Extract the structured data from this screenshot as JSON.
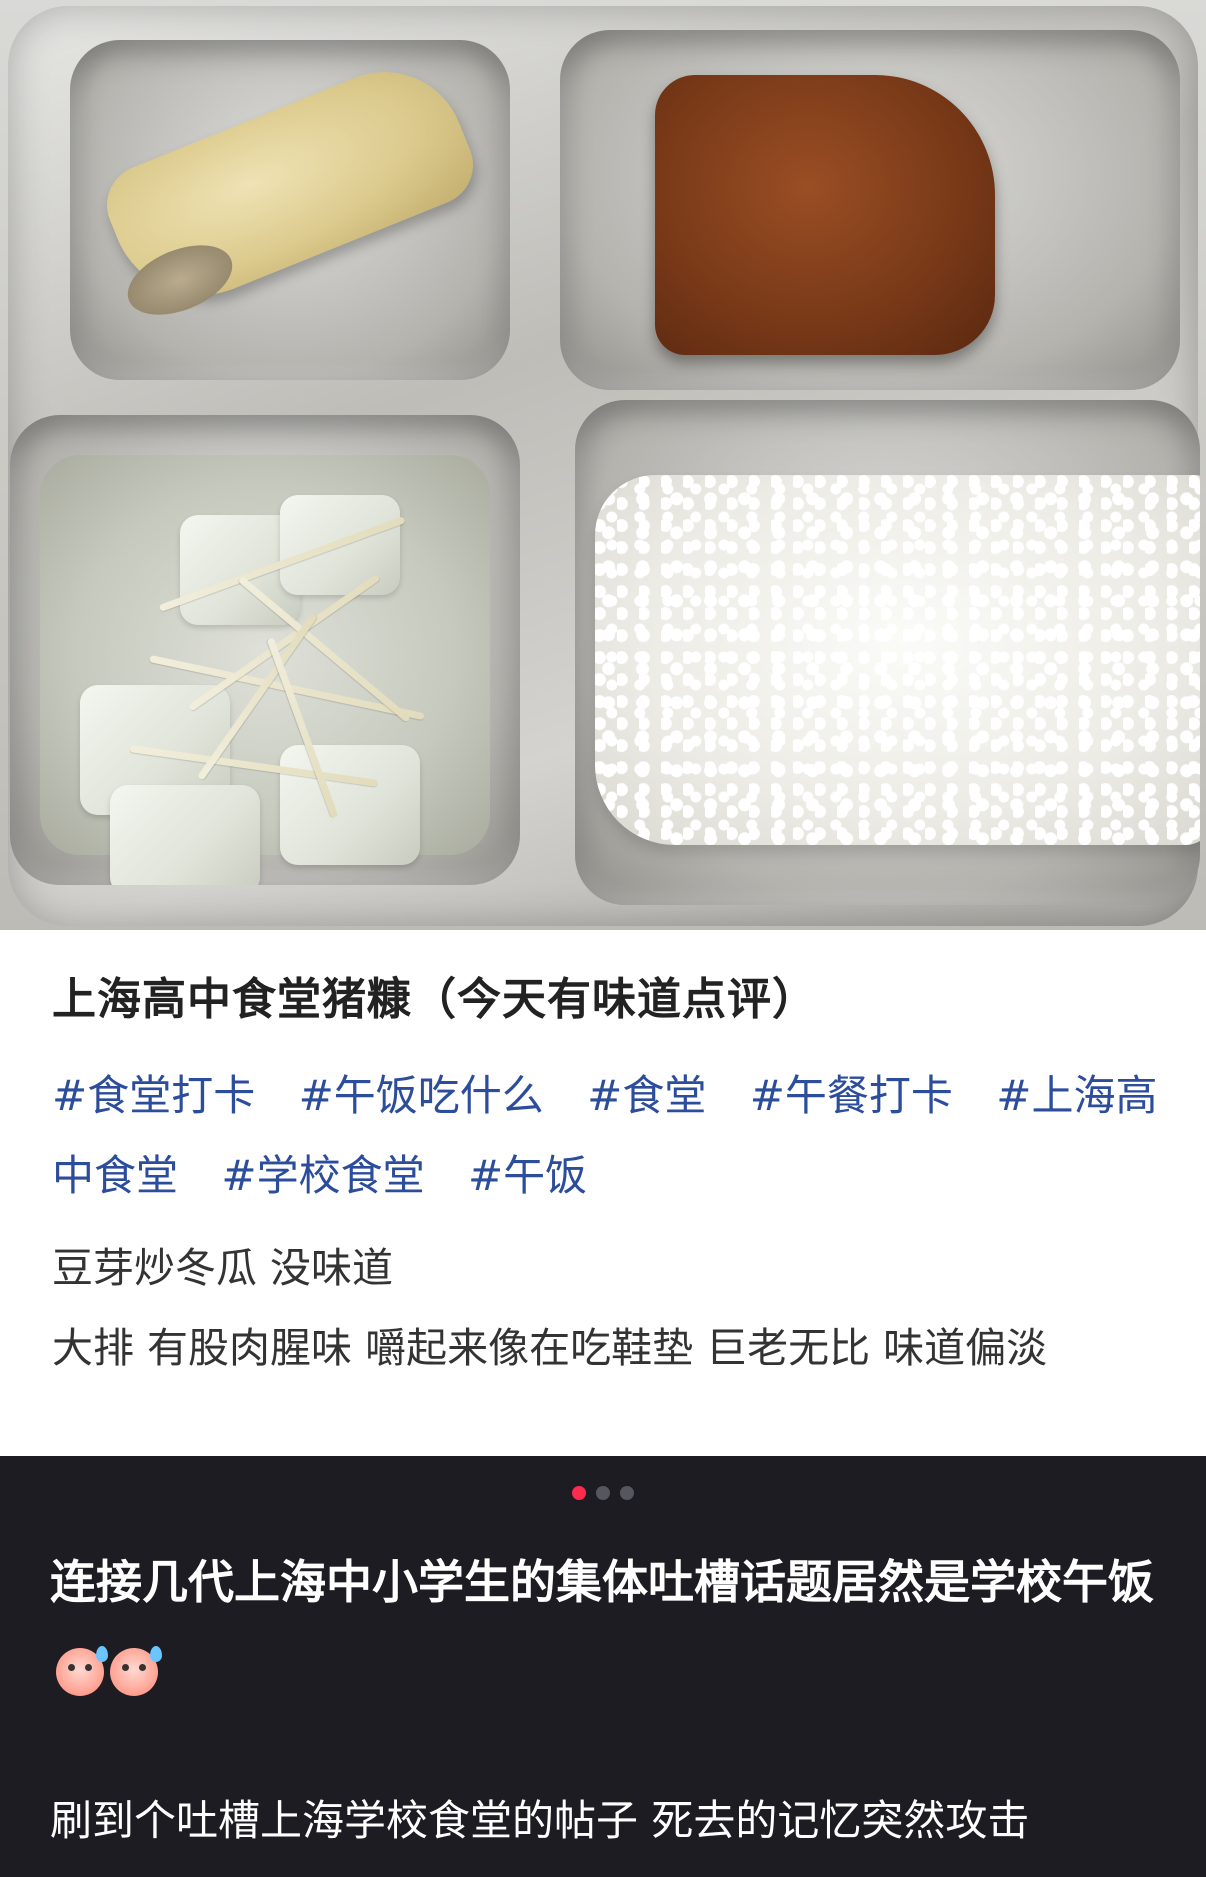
{
  "post": {
    "title": "上海高中食堂猪糠（今天有味道点评）",
    "tags": [
      "#食堂打卡",
      "#午饭吃什么",
      "#食堂",
      "#午餐打卡",
      "#上海高中食堂",
      "#学校食堂",
      "#午饭"
    ],
    "description_line1": "豆芽炒冬瓜 没味道",
    "description_line2": "大排 有股肉腥味 嚼起来像在吃鞋垫 巨老无比 味道偏淡"
  },
  "carousel": {
    "total": 3,
    "active_index": 0,
    "active_color": "#ff2b4f"
  },
  "article": {
    "headline": "连接几代上海中小学生的集体吐槽话题居然是学校午饭",
    "headline_emojis": [
      "sweat-emoji",
      "cry-laugh-emoji"
    ],
    "body": "刷到个吐槽上海学校食堂的帖子 死去的记忆突然攻击"
  },
  "photo": {
    "icon": "lunch-tray-photo"
  }
}
